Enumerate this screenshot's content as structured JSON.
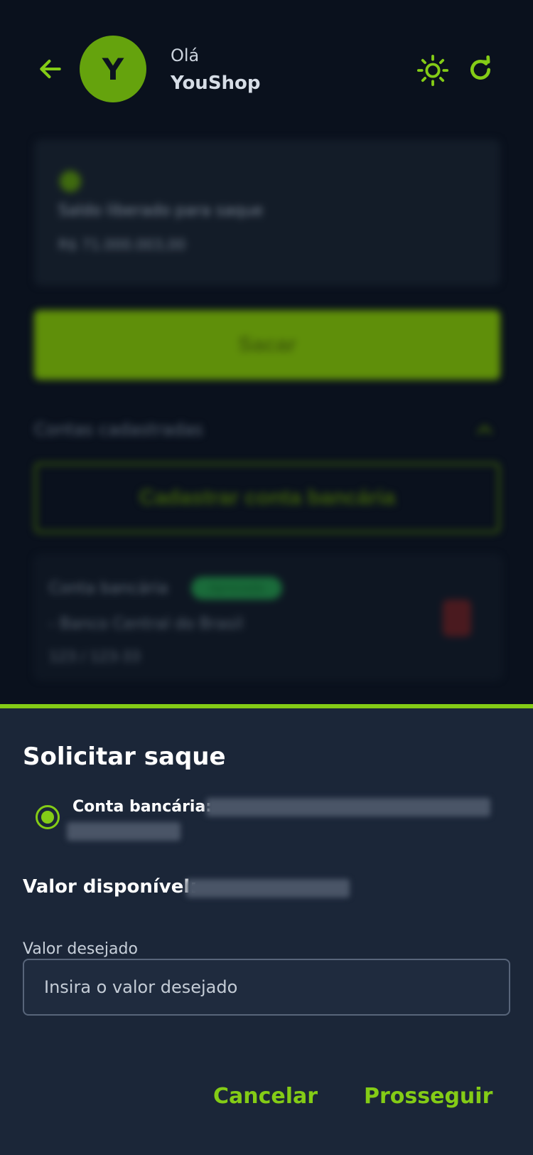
{
  "header": {
    "avatar_letter": "Y",
    "greeting": "Olá",
    "username": "YouShop"
  },
  "background": {
    "balance_label": "Saldo liberado para saque",
    "balance_value": "R$ 71.000.003,00",
    "withdraw_button": "Sacar",
    "accounts_label": "Contas cadastradas",
    "register_button": "Cadastrar conta bancária",
    "account_card": {
      "title": "Conta bancária",
      "badge": "Aprovada",
      "bank": "- Banco Central do Brasil",
      "agency": "123 / 123-33"
    }
  },
  "sheet": {
    "title": "Solicitar saque",
    "account_label": "Conta bancária:",
    "available_label": "Valor disponível:",
    "input_label": "Valor desejado",
    "input_placeholder": "Insira o valor desejado",
    "cancel_label": "Cancelar",
    "proceed_label": "Prosseguir"
  },
  "colors": {
    "accent": "#84cc16",
    "background": "#0a111d",
    "sheet": "#1b2638"
  }
}
